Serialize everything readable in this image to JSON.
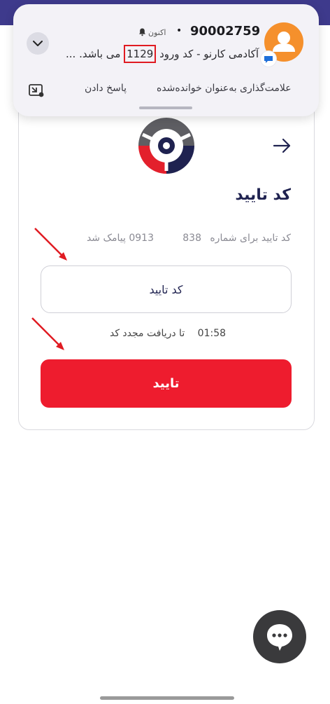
{
  "notification": {
    "sender": "90002759",
    "dot": "•",
    "time": "اکنون",
    "message_before": "آکادمی کارنو - کد ورود",
    "message_code": "1129",
    "message_after": "می باشد. ...",
    "actions": {
      "mark_read": "علامت‌گذاری به‌عنوان خوانده‌شده",
      "reply": "پاسخ دادن"
    }
  },
  "page": {
    "title": "کد تایید",
    "sent_to_label": "کد تایید برای شماره",
    "phone_suffix": "838",
    "phone_prefix_sent": "0913 پیامک شد",
    "code_input_placeholder": "کد تایید",
    "resend_timer": "01:58",
    "resend_label": "تا دریافت مجدد کد",
    "submit_label": "تایید"
  },
  "colors": {
    "brand_dark": "#1f2250",
    "accent_red": "#ee1c2e",
    "app_bar": "#3e3a8c",
    "avatar_orange": "#f5902c"
  },
  "icons": {
    "back": "arrow-right-icon",
    "expand": "chevron-down-icon",
    "muted": "bell-off-icon",
    "pip": "picture-in-picture-icon",
    "chat": "chat-bubble-icon",
    "avatar": "person-icon"
  }
}
